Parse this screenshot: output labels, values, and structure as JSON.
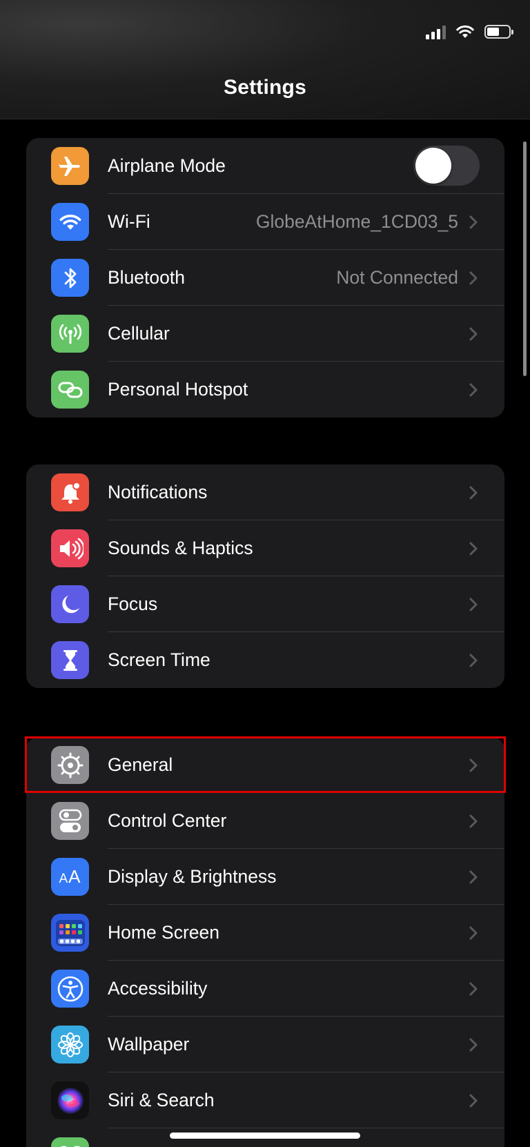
{
  "nav": {
    "title": "Settings"
  },
  "status_bar": {
    "signal_icon": "cellular-signal-icon",
    "wifi_icon": "wifi-icon",
    "battery_icon": "battery-icon",
    "battery_level": 0.55
  },
  "groups": [
    {
      "rows": [
        {
          "name": "airplane-mode",
          "label": "Airplane Mode",
          "icon": "airplane-icon",
          "icon_bg": "#F19A37",
          "toggle": false
        },
        {
          "name": "wifi",
          "label": "Wi-Fi",
          "value": "GlobeAtHome_1CD03_5",
          "icon": "wifi-icon",
          "icon_bg": "#3478F6"
        },
        {
          "name": "bluetooth",
          "label": "Bluetooth",
          "value": "Not Connected",
          "icon": "bluetooth-icon",
          "icon_bg": "#3478F6"
        },
        {
          "name": "cellular",
          "label": "Cellular",
          "icon": "antenna-icon",
          "icon_bg": "#65C466"
        },
        {
          "name": "personal-hotspot",
          "label": "Personal Hotspot",
          "icon": "chain-link-icon",
          "icon_bg": "#65C466"
        }
      ]
    },
    {
      "rows": [
        {
          "name": "notifications",
          "label": "Notifications",
          "icon": "bell-icon",
          "icon_bg": "#EB4E3D"
        },
        {
          "name": "sounds-haptics",
          "label": "Sounds & Haptics",
          "icon": "speaker-icon",
          "icon_bg": "#EB445A"
        },
        {
          "name": "focus",
          "label": "Focus",
          "icon": "moon-icon",
          "icon_bg": "#5E5CE6"
        },
        {
          "name": "screen-time",
          "label": "Screen Time",
          "icon": "hourglass-icon",
          "icon_bg": "#5E5CE6"
        }
      ]
    },
    {
      "rows": [
        {
          "name": "general",
          "label": "General",
          "icon": "gear-icon",
          "icon_bg": "#8E8E93",
          "highlighted": true
        },
        {
          "name": "control-center",
          "label": "Control Center",
          "icon": "switches-icon",
          "icon_bg": "#8E8E93"
        },
        {
          "name": "display-brightness",
          "label": "Display & Brightness",
          "icon": "text-size-icon",
          "icon_bg": "#3478F6"
        },
        {
          "name": "home-screen",
          "label": "Home Screen",
          "icon": "app-grid-icon",
          "icon_bg": "#2E5BE0"
        },
        {
          "name": "accessibility",
          "label": "Accessibility",
          "icon": "accessibility-icon",
          "icon_bg": "#3478F6"
        },
        {
          "name": "wallpaper",
          "label": "Wallpaper",
          "icon": "flower-icon",
          "icon_bg": "#36A9E1"
        },
        {
          "name": "siri-search",
          "label": "Siri & Search",
          "icon": "siri-icon",
          "icon_bg": "#111111"
        },
        {
          "name": "face-id",
          "label": "",
          "icon": "face-id-icon",
          "icon_bg": "#65C466"
        }
      ]
    }
  ],
  "colors": {
    "highlight": "#E00000",
    "separator": "#38383A",
    "group_bg": "#1C1C1E"
  }
}
